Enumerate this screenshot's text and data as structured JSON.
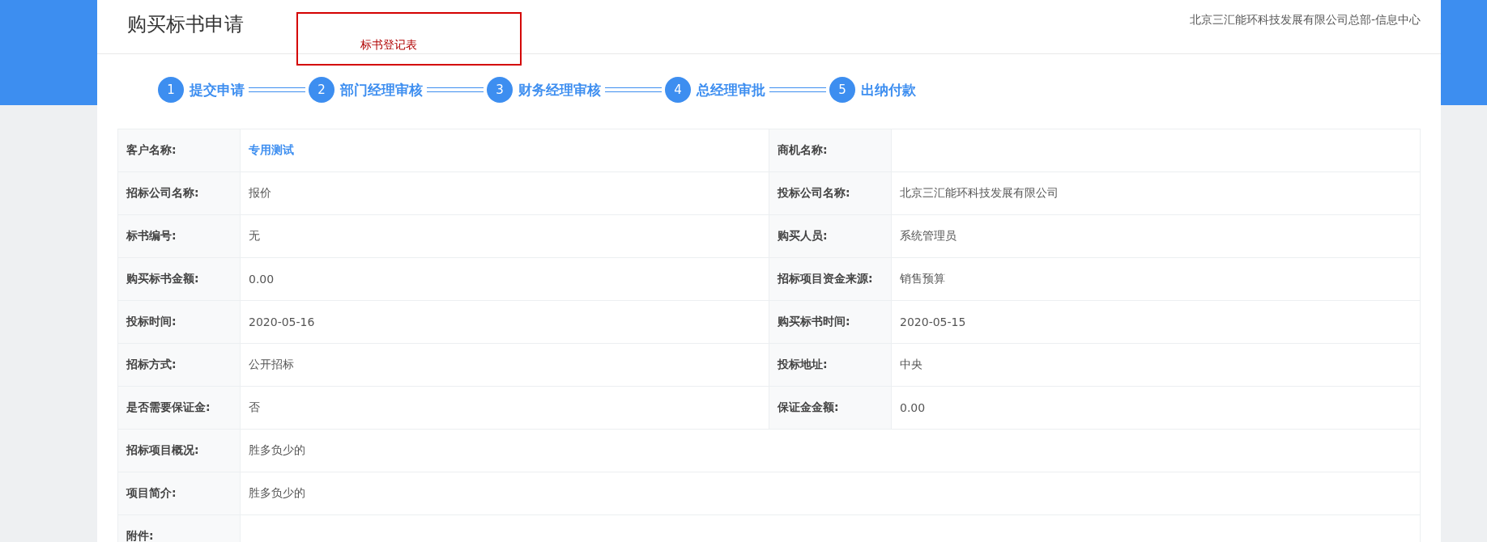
{
  "header": {
    "title": "购买标书申请",
    "org": "北京三汇能环科技发展有限公司总部-信息中心"
  },
  "popup": {
    "text": "标书登记表"
  },
  "steps": [
    {
      "number": "1",
      "label": "提交申请"
    },
    {
      "number": "2",
      "label": "部门经理审核"
    },
    {
      "number": "3",
      "label": "财务经理审核"
    },
    {
      "number": "4",
      "label": "总经理审批"
    },
    {
      "number": "5",
      "label": "出纳付款"
    }
  ],
  "rows": [
    {
      "cells": [
        {
          "label": "客户名称:",
          "value": "专用测试",
          "kind": "link"
        },
        {
          "label": "商机名称:",
          "kind": "text"
        }
      ]
    },
    {
      "cells": [
        {
          "label": "招标公司名称:",
          "value": "报价",
          "kind": "text"
        },
        {
          "label": "投标公司名称:",
          "value": "北京三汇能环科技发展有限公司",
          "kind": "text"
        }
      ]
    },
    {
      "cells": [
        {
          "label": "标书编号:",
          "value": "无",
          "kind": "text"
        },
        {
          "label": "购买人员:",
          "value": "系统管理员",
          "kind": "text"
        }
      ]
    },
    {
      "cells": [
        {
          "label": "购买标书金额:",
          "value": "0.00",
          "kind": "text"
        },
        {
          "label": "招标项目资金来源:",
          "value": "销售预算",
          "kind": "text"
        }
      ]
    },
    {
      "cells": [
        {
          "label": "投标时间:",
          "value": "2020-05-16",
          "kind": "text"
        },
        {
          "label": "购买标书时间:",
          "value": "2020-05-15",
          "kind": "text"
        }
      ]
    },
    {
      "cells": [
        {
          "label": "招标方式:",
          "value": "公开招标",
          "kind": "text"
        },
        {
          "label": "投标地址:",
          "value": "中央",
          "kind": "text"
        }
      ]
    },
    {
      "cells": [
        {
          "label": "是否需要保证金:",
          "value": "否",
          "kind": "text"
        },
        {
          "label": "保证金金额:",
          "value": "0.00",
          "kind": "text"
        }
      ]
    },
    {
      "cells": [
        {
          "label": "招标项目概况:",
          "value": "胜多负少的",
          "kind": "text"
        }
      ]
    },
    {
      "cells": [
        {
          "label": "项目简介:",
          "value": "胜多负少的",
          "kind": "text"
        }
      ]
    },
    {
      "cells": [
        {
          "label": "附件:",
          "kind": "text"
        }
      ]
    }
  ]
}
